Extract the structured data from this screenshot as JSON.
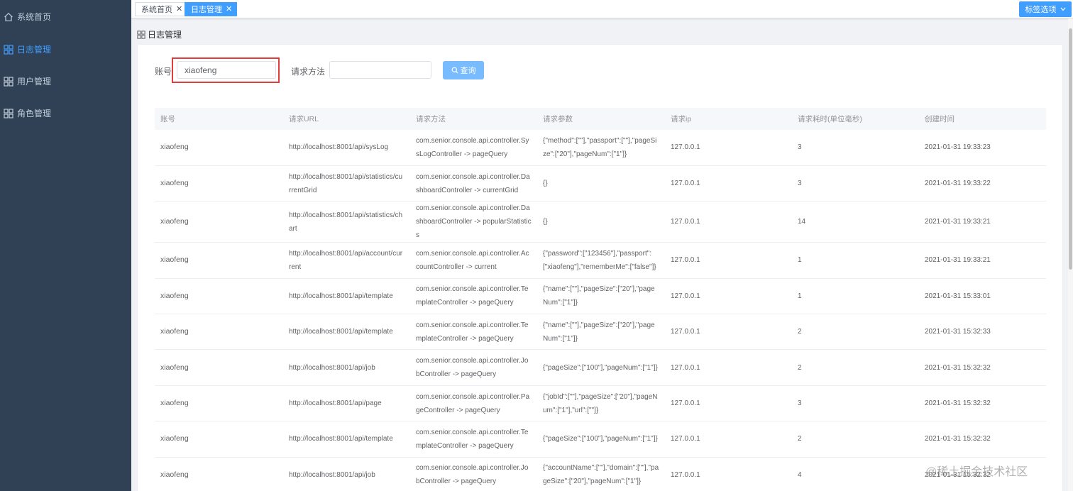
{
  "sidebar": {
    "items": [
      {
        "label": "系统首页",
        "icon": "home-icon",
        "active": false
      },
      {
        "label": "日志管理",
        "icon": "grid-icon",
        "active": true
      },
      {
        "label": "用户管理",
        "icon": "grid-icon",
        "active": false
      },
      {
        "label": "角色管理",
        "icon": "grid-icon",
        "active": false
      }
    ]
  },
  "tabs": [
    {
      "label": "系统首页",
      "active": false
    },
    {
      "label": "日志管理",
      "active": true
    }
  ],
  "tags_option_label": "标签选项",
  "breadcrumb": {
    "label": "日志管理"
  },
  "form": {
    "account_label": "账号",
    "account_value": "xiaofeng",
    "method_label": "请求方法",
    "method_value": "",
    "search_label": "查询"
  },
  "table": {
    "columns": [
      "账号",
      "请求URL",
      "请求方法",
      "请求参数",
      "请求ip",
      "请求耗时(单位毫秒)",
      "创建时间"
    ],
    "rows": [
      [
        "xiaofeng",
        "http://localhost:8001/api/sysLog",
        "com.senior.console.api.controller.SysLogController -> pageQuery",
        "{\"method\":[\"\"],\"passport\":[\"\"],\"pageSize\":[\"20\"],\"pageNum\":[\"1\"]}",
        "127.0.0.1",
        "3",
        "2021-01-31 19:33:23"
      ],
      [
        "xiaofeng",
        "http://localhost:8001/api/statistics/currentGrid",
        "com.senior.console.api.controller.DashboardController -> currentGrid",
        "{}",
        "127.0.0.1",
        "3",
        "2021-01-31 19:33:22"
      ],
      [
        "xiaofeng",
        "http://localhost:8001/api/statistics/chart",
        "com.senior.console.api.controller.DashboardController -> popularStatistics",
        "{}",
        "127.0.0.1",
        "14",
        "2021-01-31 19:33:21"
      ],
      [
        "xiaofeng",
        "http://localhost:8001/api/account/current",
        "com.senior.console.api.controller.AccountController -> current",
        "{\"password\":[\"123456\"],\"passport\":[\"xiaofeng\"],\"rememberMe\":[\"false\"]}",
        "127.0.0.1",
        "1",
        "2021-01-31 19:33:21"
      ],
      [
        "xiaofeng",
        "http://localhost:8001/api/template",
        "com.senior.console.api.controller.TemplateController -> pageQuery",
        "{\"name\":[\"\"],\"pageSize\":[\"20\"],\"pageNum\":[\"1\"]}",
        "127.0.0.1",
        "1",
        "2021-01-31 15:33:01"
      ],
      [
        "xiaofeng",
        "http://localhost:8001/api/template",
        "com.senior.console.api.controller.TemplateController -> pageQuery",
        "{\"name\":[\"\"],\"pageSize\":[\"20\"],\"pageNum\":[\"1\"]}",
        "127.0.0.1",
        "2",
        "2021-01-31 15:32:33"
      ],
      [
        "xiaofeng",
        "http://localhost:8001/api/job",
        "com.senior.console.api.controller.JobController -> pageQuery",
        "{\"pageSize\":[\"100\"],\"pageNum\":[\"1\"]}",
        "127.0.0.1",
        "2",
        "2021-01-31 15:32:32"
      ],
      [
        "xiaofeng",
        "http://localhost:8001/api/page",
        "com.senior.console.api.controller.PageController -> pageQuery",
        "{\"jobId\":[\"\"],\"pageSize\":[\"20\"],\"pageNum\":[\"1\"],\"url\":[\"\"]}",
        "127.0.0.1",
        "3",
        "2021-01-31 15:32:32"
      ],
      [
        "xiaofeng",
        "http://localhost:8001/api/template",
        "com.senior.console.api.controller.TemplateController -> pageQuery",
        "{\"pageSize\":[\"100\"],\"pageNum\":[\"1\"]}",
        "127.0.0.1",
        "2",
        "2021-01-31 15:32:32"
      ],
      [
        "xiaofeng",
        "http://localhost:8001/api/job",
        "com.senior.console.api.controller.JobController -> pageQuery",
        "{\"accountName\":[\"\"],\"domain\":[\"\"],\"pageSize\":[\"20\"],\"pageNum\":[\"1\"]}",
        "127.0.0.1",
        "4",
        "2021-01-31 15:32:32"
      ]
    ]
  },
  "watermark": "@稀土掘金技术社区",
  "colors": {
    "sidebar_bg": "#304156",
    "accent": "#409eff",
    "highlight": "#e43b3b"
  }
}
